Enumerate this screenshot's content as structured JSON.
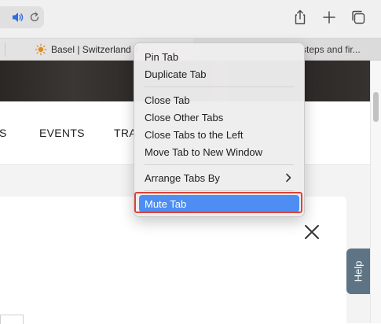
{
  "toolbar": {
    "share_label": "Share",
    "new_tab_label": "New Tab",
    "tab_overview_label": "Show Tab Overview"
  },
  "tabs": [
    {
      "title": "Basel | Switzerland T"
    },
    {
      "title": "steps and fir..."
    }
  ],
  "nav": {
    "items": [
      "S",
      "EVENTS",
      "TRA"
    ]
  },
  "help": {
    "label": "Help"
  },
  "context_menu": {
    "items": [
      {
        "label": "Pin Tab"
      },
      {
        "label": "Duplicate Tab"
      },
      {
        "label": "Close Tab"
      },
      {
        "label": "Close Other Tabs"
      },
      {
        "label": "Close Tabs to the Left"
      },
      {
        "label": "Move Tab to New Window"
      },
      {
        "label": "Arrange Tabs By",
        "submenu": true
      },
      {
        "label": "Mute Tab",
        "highlighted": true
      }
    ]
  },
  "colors": {
    "menu_highlight": "#4e8ef2",
    "highlight_outline": "#e0413b",
    "help_tab": "#5e7484",
    "speaker_icon": "#2f6fe0"
  },
  "icons": {
    "speaker": "speaker-icon",
    "reload": "reload-icon",
    "share": "share-icon",
    "plus": "plus-icon",
    "tabs": "tabs-overview-icon",
    "favicon": "sun-icon",
    "close": "close-icon",
    "submenu": "chevron-right-icon"
  }
}
